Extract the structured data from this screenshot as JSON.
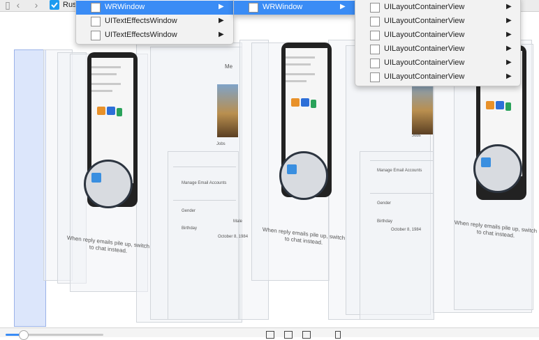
{
  "toolbar": {
    "back_icon": "chevron-left-icon",
    "forward_icon": "chevron-right-icon",
    "app_icon": "checkbox-app-icon",
    "title": "Rus"
  },
  "menus": [
    {
      "items": [
        {
          "label": "WRWindow",
          "selected": true
        },
        {
          "label": "UITextEffectsWindow",
          "selected": false
        },
        {
          "label": "UITextEffectsWindow",
          "selected": false
        }
      ]
    },
    {
      "items": [
        {
          "label": "WRWindow",
          "selected": true
        }
      ]
    },
    {
      "items": [
        {
          "label": "UILayoutContainerView",
          "selected": false
        },
        {
          "label": "UILayoutContainerView",
          "selected": false
        },
        {
          "label": "UILayoutContainerView",
          "selected": false
        },
        {
          "label": "UILayoutContainerView",
          "selected": false
        },
        {
          "label": "UILayoutContainerView",
          "selected": false
        },
        {
          "label": "UILayoutContainerView",
          "selected": false
        }
      ]
    }
  ],
  "canvas": {
    "captions": [
      "When reply emails pile up, switch to chat instead.",
      "When reply emails pile up, switch to chat instead.",
      "When reply emails pile up, switch to chat instead."
    ],
    "profile": {
      "header": "Me",
      "name": "Jobs",
      "manage_email": "Manage Email Accounts",
      "gender_label": "Gender",
      "gender_value": "Male",
      "birthday_label": "Birthday",
      "birthday_value": "October 8, 1984"
    }
  },
  "colors": {
    "accent": "#3a8cf5",
    "selection_highlight": "#3a8cf5",
    "menu_background": "#f2f2f2"
  },
  "slider": {
    "value_fraction": 0.18
  }
}
